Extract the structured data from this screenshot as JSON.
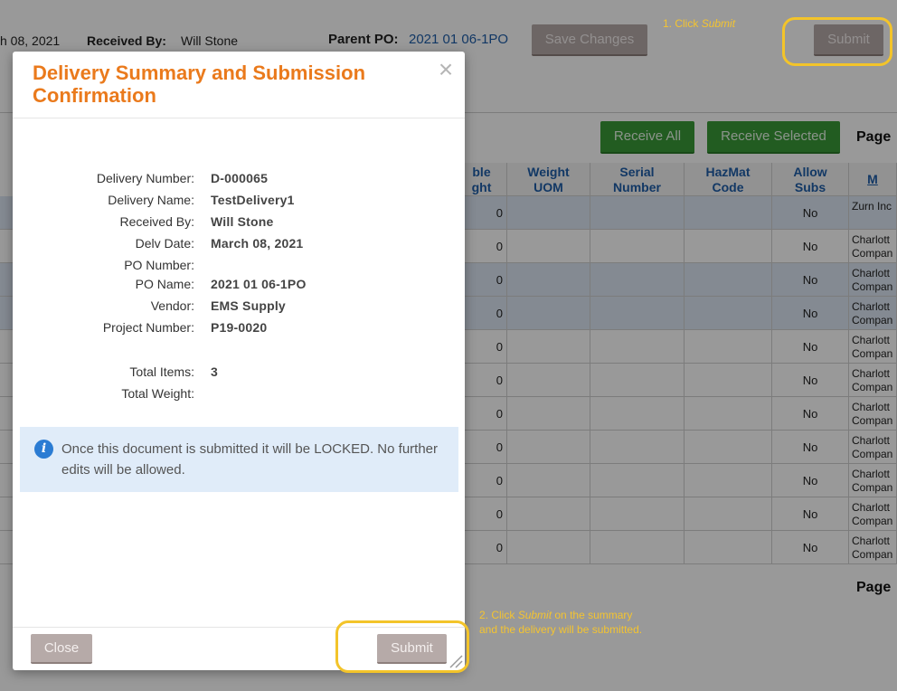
{
  "header": {
    "date_fragment": "h 08, 2021",
    "received_by_label": "Received By:",
    "received_by_value": "Will Stone",
    "parent_po_label": "Parent PO:",
    "parent_po_value": "2021 01 06-1PO",
    "save_changes_label": "Save Changes",
    "submit_label": "Submit"
  },
  "toolbar": {
    "receive_all_label": "Receive All",
    "receive_selected_label": "Receive Selected",
    "page_label": "Page"
  },
  "grid": {
    "columns": [
      {
        "line1": "ble",
        "line2": "ght"
      },
      {
        "line1": "Weight",
        "line2": "UOM"
      },
      {
        "line1": "Serial",
        "line2": "Number"
      },
      {
        "line1": "HazMat",
        "line2": "Code"
      },
      {
        "line1": "Allow",
        "line2": "Subs"
      },
      {
        "line1": "M",
        "line2": ""
      }
    ],
    "rows": [
      {
        "weight": "0",
        "subs": "No",
        "mfr1": "Zurn Inc",
        "mfr2": ""
      },
      {
        "weight": "0",
        "subs": "No",
        "mfr1": "Charlott",
        "mfr2": "Compan"
      },
      {
        "weight": "0",
        "subs": "No",
        "mfr1": "Charlott",
        "mfr2": "Compan"
      },
      {
        "weight": "0",
        "subs": "No",
        "mfr1": "Charlott",
        "mfr2": "Compan"
      },
      {
        "weight": "0",
        "subs": "No",
        "mfr1": "Charlott",
        "mfr2": "Compan"
      },
      {
        "weight": "0",
        "subs": "No",
        "mfr1": "Charlott",
        "mfr2": "Compan"
      },
      {
        "weight": "0",
        "subs": "No",
        "mfr1": "Charlott",
        "mfr2": "Compan"
      },
      {
        "weight": "0",
        "subs": "No",
        "mfr1": "Charlott",
        "mfr2": "Compan"
      },
      {
        "weight": "0",
        "subs": "No",
        "mfr1": "Charlott",
        "mfr2": "Compan"
      },
      {
        "weight": "0",
        "subs": "No",
        "mfr1": "Charlott",
        "mfr2": "Compan"
      },
      {
        "weight": "0",
        "subs": "No",
        "mfr1": "Charlott",
        "mfr2": "Compan"
      }
    ],
    "footer_page_label": "Page"
  },
  "annotations": {
    "step1_prefix": "1. Click ",
    "step1_em": "Submit",
    "step2_prefix": "2. Click ",
    "step2_em": "Submit",
    "step2_suffix": " on the summary",
    "step2_line2": "and the delivery will be submitted."
  },
  "modal": {
    "title": "Delivery Summary and Submission Confirmation",
    "close_glyph": "×",
    "fields": [
      {
        "label": "Delivery Number:",
        "value": "D-000065"
      },
      {
        "label": "Delivery Name:",
        "value": "TestDelivery1"
      },
      {
        "label": "Received By:",
        "value": "Will Stone"
      },
      {
        "label": "Delv Date:",
        "value": "March 08, 2021"
      },
      {
        "label": "PO Number:",
        "value": ""
      },
      {
        "label": "PO Name:",
        "value": "2021 01 06-1PO"
      },
      {
        "label": "Vendor:",
        "value": "EMS Supply"
      },
      {
        "label": "Project Number:",
        "value": "P19-0020"
      }
    ],
    "totals": [
      {
        "label": "Total Items:",
        "value": "3"
      },
      {
        "label": "Total Weight:",
        "value": ""
      }
    ],
    "info_icon_glyph": "i",
    "info_text": "Once this document is submitted it will be LOCKED. No further edits will be allowed.",
    "close_button_label": "Close",
    "submit_button_label": "Submit"
  },
  "colors": {
    "title_orange": "#ea7a1c",
    "annotation_yellow": "#f3c42a",
    "info_blue": "#2b7cd3",
    "link_blue": "#1f5ea8",
    "button_grey": "#b6aaa8",
    "button_green": "#3a9a37"
  }
}
